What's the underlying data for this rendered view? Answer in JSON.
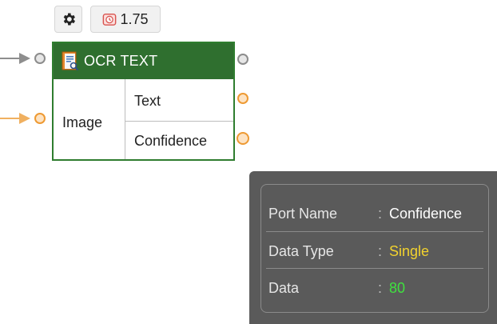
{
  "toolbar": {
    "settings_icon": "gear-icon",
    "time_icon": "clock-icon",
    "time_value": "1.75"
  },
  "node": {
    "title": "OCR TEXT",
    "title_icon": "ocr-document-icon",
    "header_color": "#2f6f2f",
    "inputs": [
      {
        "label": "Image",
        "port_color": "#ee9a33"
      }
    ],
    "outputs": [
      {
        "label": "Text",
        "port_color": "#ee9a33"
      },
      {
        "label": "Confidence",
        "port_color": "#ee9a33"
      }
    ]
  },
  "tooltip": {
    "rows": [
      {
        "key": "Port Name",
        "value": "Confidence",
        "color": "#ffffff"
      },
      {
        "key": "Data Type",
        "value": "Single",
        "color": "#f2d22e"
      },
      {
        "key": "Data",
        "value": "80",
        "color": "#3fe23f"
      }
    ],
    "separator": ":"
  }
}
